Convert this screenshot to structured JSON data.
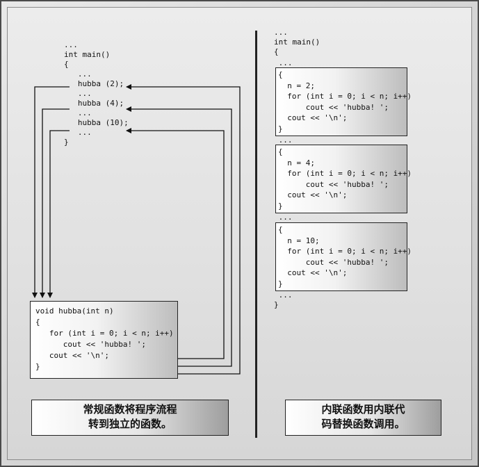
{
  "left_panel": {
    "main_code": [
      "...",
      "int main()",
      "{",
      "   ...",
      "   hubba (2);",
      "   ...",
      "   hubba (4);",
      "   ...",
      "   hubba (10);",
      "   ...",
      "}"
    ],
    "function_code": [
      "void hubba(int n)",
      "{",
      "   for (int i = 0; i < n; i++)",
      "      cout << 'hubba! ';",
      "   cout << '\\n';",
      "}"
    ],
    "caption_lines": [
      "常规函数将程序流程",
      "转到独立的函数。"
    ]
  },
  "right_panel": {
    "main_header": [
      "...",
      "int main()",
      "{"
    ],
    "inline_blocks": [
      {
        "dots": " ...",
        "code": [
          "{",
          "  n = 2;",
          "  for (int i = 0; i < n; i++)",
          "      cout << 'hubba! ';",
          "  cout << '\\n';",
          "}"
        ]
      },
      {
        "dots": " ...",
        "code": [
          "{",
          "  n = 4;",
          "  for (int i = 0; i < n; i++)",
          "      cout << 'hubba! ';",
          "  cout << '\\n';",
          "}"
        ]
      },
      {
        "dots": " ...",
        "code": [
          "{",
          "  n = 10;",
          "  for (int i = 0; i < n; i++)",
          "      cout << 'hubba! ';",
          "  cout << '\\n';",
          "}"
        ]
      }
    ],
    "main_footer": [
      " ...",
      "}"
    ],
    "caption_lines": [
      "内联函数用内联代",
      "码替换函数调用。"
    ]
  }
}
